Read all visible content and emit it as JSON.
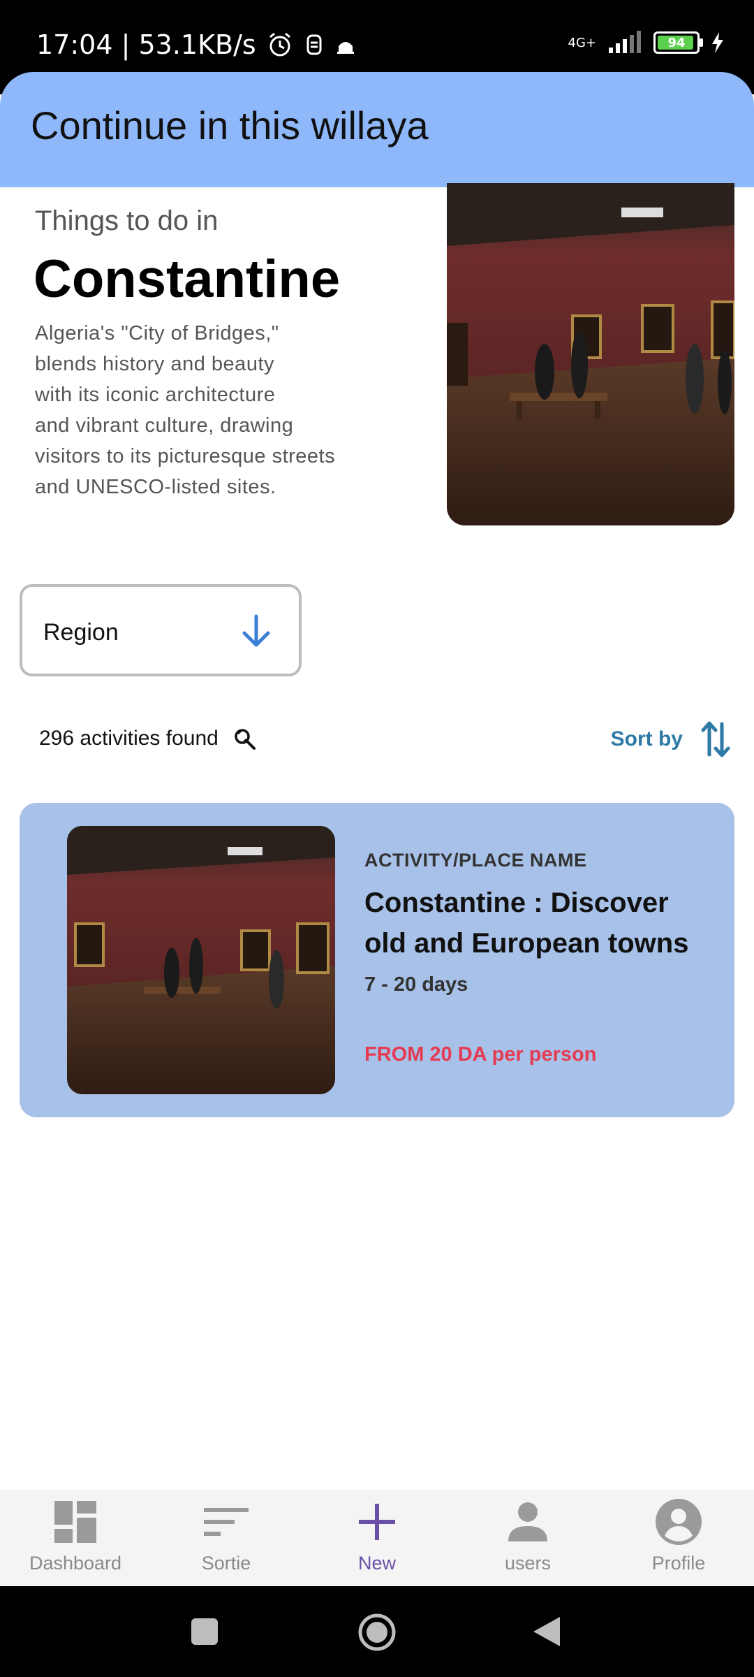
{
  "status_bar": {
    "time_speed": "17:04 | 53.1KB/s",
    "network": "4G+",
    "battery": "94"
  },
  "header": {
    "title": "Continue in this willaya"
  },
  "intro": {
    "subtitle": "Things to do in",
    "city": "Constantine",
    "description": "Algeria's \"City of Bridges,\"\n blends history and beauty\n with its iconic architecture\n and vibrant culture, drawing\n visitors to its picturesque streets\n and UNESCO-listed sites."
  },
  "filters": {
    "region_label": "Region",
    "results_text": "296 activities found",
    "sort_label": "Sort by"
  },
  "card": {
    "kicker": "ACTIVITY/PLACE NAME",
    "title": "Constantine : Discover\n old and European towns",
    "duration": "7 - 20 days",
    "price": "FROM 20 DA per person"
  },
  "bottom_nav": {
    "items": [
      {
        "label": "Dashboard",
        "icon": "dashboard-icon"
      },
      {
        "label": "Sortie",
        "icon": "sort-lines-icon"
      },
      {
        "label": "New",
        "icon": "plus-icon"
      },
      {
        "label": "users",
        "icon": "person-icon"
      },
      {
        "label": "Profile",
        "icon": "account-circle-icon"
      }
    ]
  },
  "colors": {
    "header_bg": "#8fb8fb",
    "card_bg": "#a7c1e8",
    "accent_blue": "#2d7aa6",
    "price_red": "#e53b52",
    "active_nav": "#6a4fa6"
  }
}
